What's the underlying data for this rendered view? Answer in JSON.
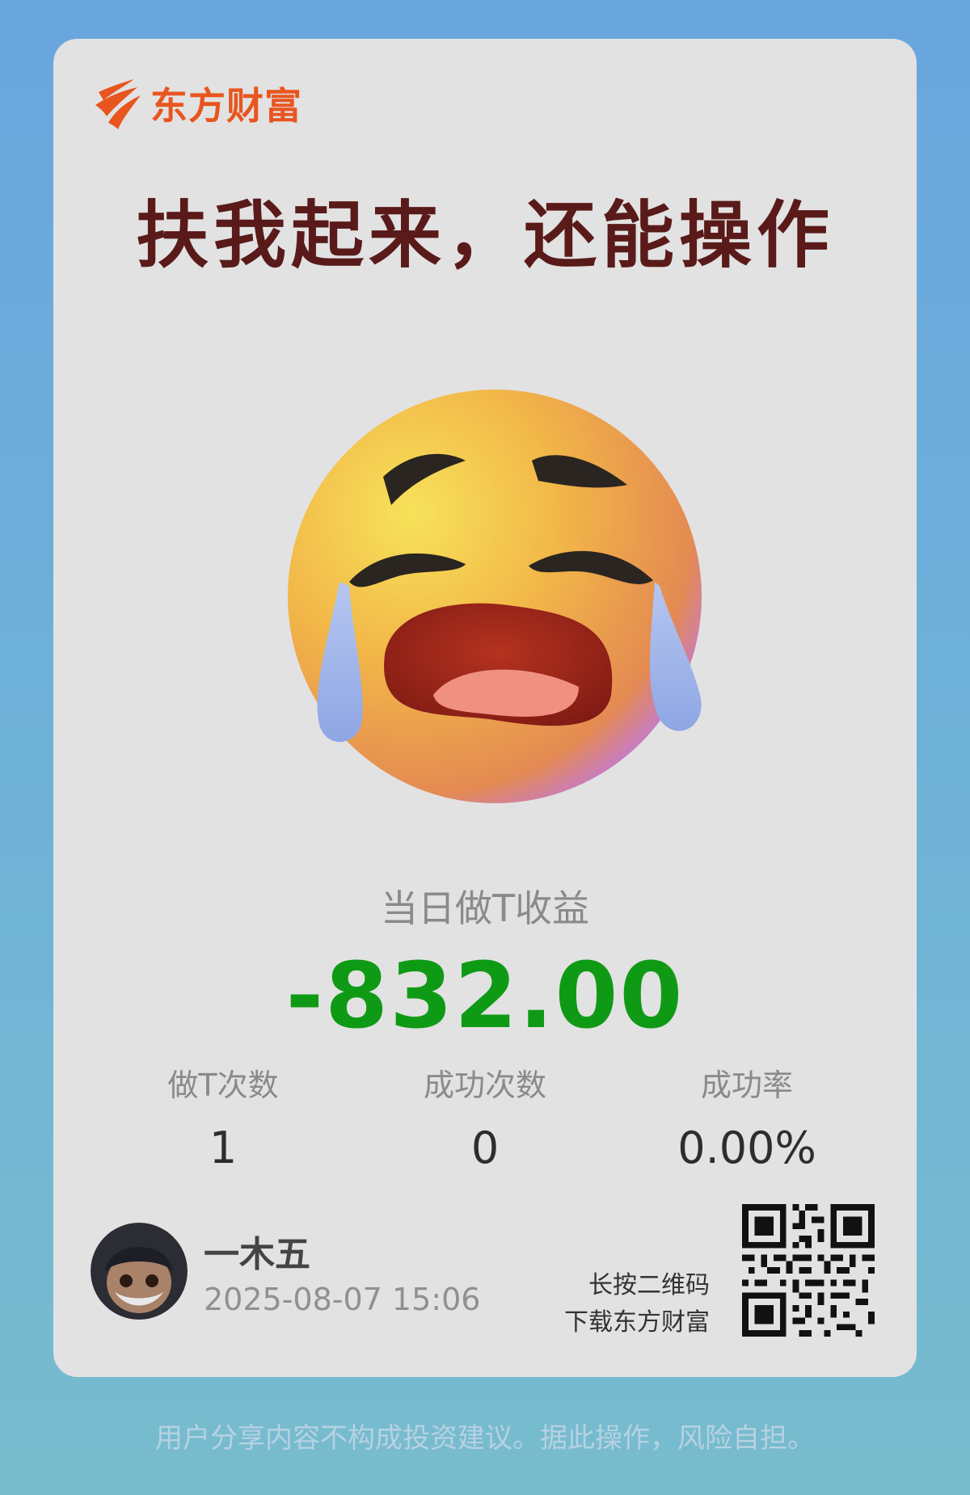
{
  "brand": {
    "name": "东方财富",
    "color": "#e8551f"
  },
  "headline": "扶我起来，还能操作",
  "emoji": {
    "icon": "loudly-crying-face-icon"
  },
  "metric": {
    "label": "当日做T收益",
    "value": "-832.00",
    "color": "#0f9a15"
  },
  "stats": [
    {
      "label": "做T次数",
      "value": "1"
    },
    {
      "label": "成功次数",
      "value": "0"
    },
    {
      "label": "成功率",
      "value": "0.00%"
    }
  ],
  "user": {
    "name": "一木五",
    "timestamp": "2025-08-07 15:06"
  },
  "qr": {
    "caption_line1": "长按二维码",
    "caption_line2": "下载东方财富"
  },
  "disclaimer": "用户分享内容不构成投资建议。据此操作，风险自担。"
}
